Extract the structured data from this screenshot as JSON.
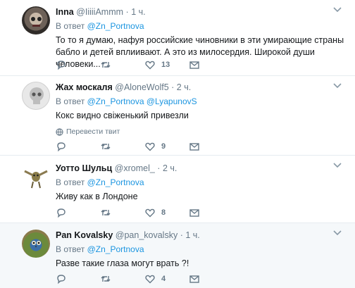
{
  "replies": [
    {
      "name": "Inna",
      "handle": "@IiiiiAmmm",
      "separator": "·",
      "time": "1 ч.",
      "reply_prefix": "В ответ",
      "reply_to": "@Zn_Portnova",
      "text": "То то я думаю, нафуя российские чиновники в эти умирающие страны бабло и детей вплиивают. А это из милосердия. Широкой души человеки...",
      "reply_count": "",
      "retweet_count": "",
      "like_count": "13",
      "highlight": false
    },
    {
      "name": "Жах москаля",
      "handle": "@AloneWolf5",
      "separator": "·",
      "time": "2 ч.",
      "reply_prefix": "В ответ",
      "reply_to": "@Zn_Portnova @LyapunovS",
      "text": "Кокс видно свiженький привезли",
      "translate_label": "Перевести твит",
      "reply_count": "",
      "retweet_count": "",
      "like_count": "9",
      "highlight": false
    },
    {
      "name": "Уотто Шульц",
      "handle": "@xromel_",
      "separator": "·",
      "time": "2 ч.",
      "reply_prefix": "В ответ",
      "reply_to": "@Zn_Portnova",
      "text": "Живу как в Лондоне",
      "reply_count": "",
      "retweet_count": "",
      "like_count": "8",
      "highlight": false
    },
    {
      "name": "Pan Kovalsky",
      "handle": "@pan_kovalsky",
      "separator": "·",
      "time": "1 ч.",
      "reply_prefix": "В ответ",
      "reply_to": "@Zn_Portnova",
      "text": "Разве такие глаза могут врать ?!",
      "reply_count": "",
      "retweet_count": "",
      "like_count": "4",
      "highlight": true
    }
  ],
  "colors": {
    "link": "#1b95e0",
    "secondary_text": "#657786",
    "divider": "#e6ecf0",
    "highlight_bg": "#f5f8fa"
  },
  "icons": [
    "reply-icon",
    "retweet-icon",
    "like-icon",
    "direct-message-icon",
    "globe-icon",
    "chevron-down-icon"
  ]
}
